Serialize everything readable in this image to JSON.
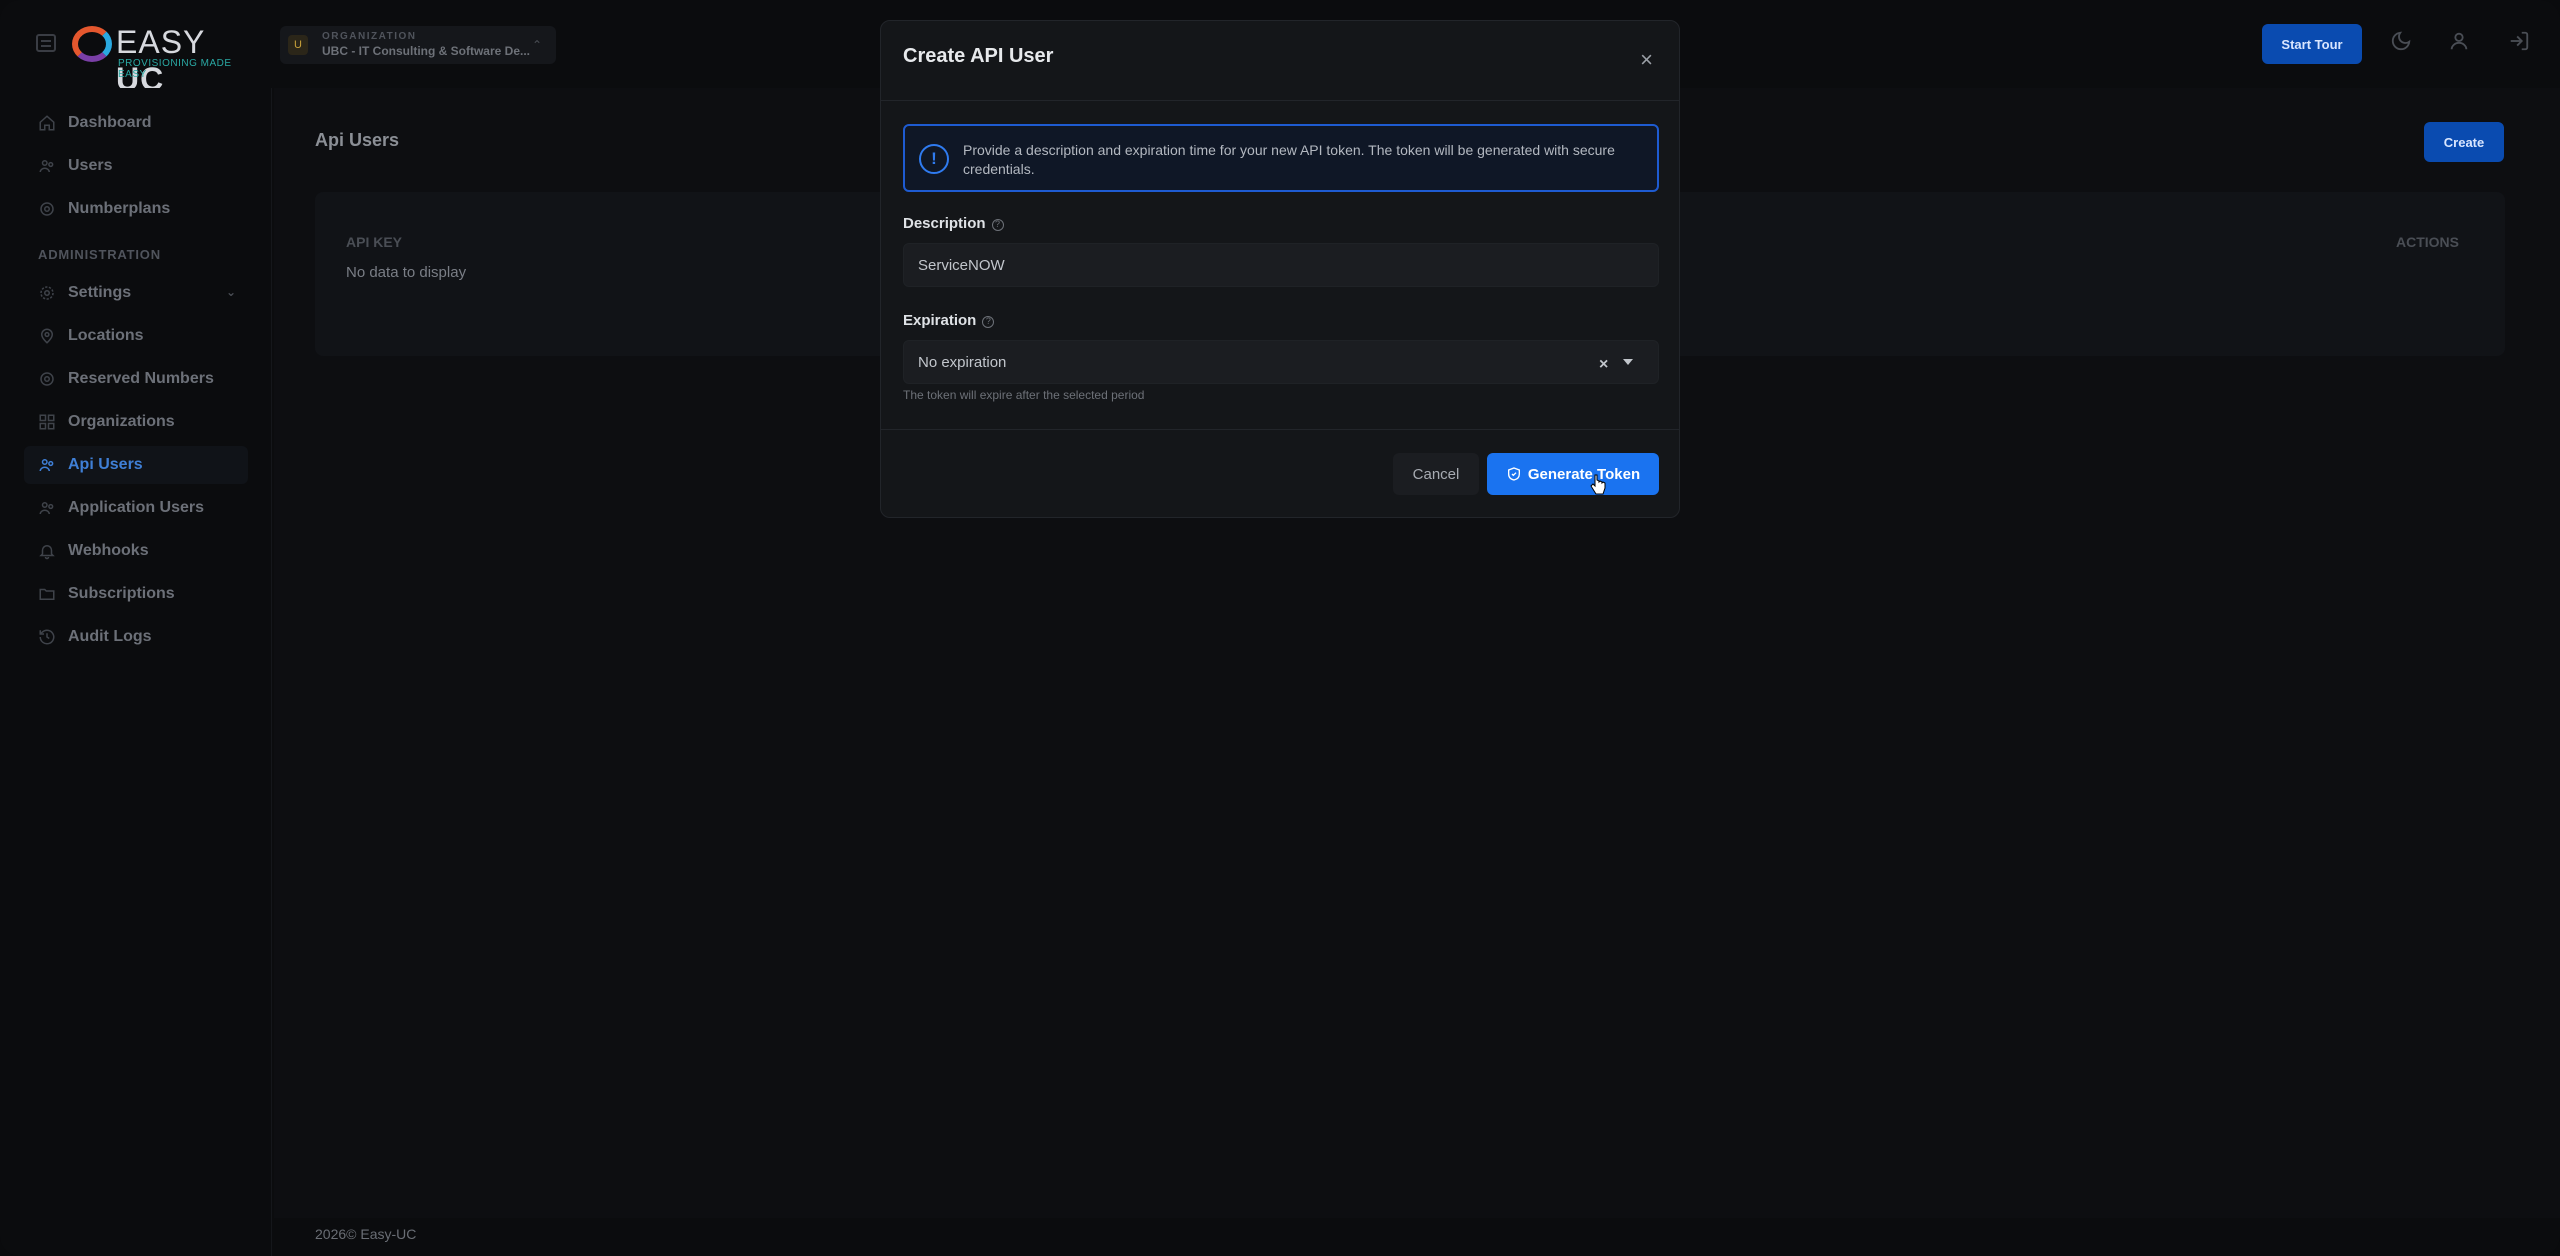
{
  "brand": {
    "logo_text_light": "EASY",
    "logo_text_bold": "UC",
    "tagline": "PROVISIONING MADE EASY"
  },
  "org_selector": {
    "label": "ORGANIZATION",
    "avatar": "U",
    "name": "UBC - IT Consulting & Software De..."
  },
  "header": {
    "start_tour": "Start Tour",
    "icons": [
      "moon-icon",
      "user-icon",
      "logout-icon"
    ]
  },
  "sidebar": {
    "items": [
      {
        "label": "Dashboard",
        "icon": "home-icon"
      },
      {
        "label": "Users",
        "icon": "users-icon"
      },
      {
        "label": "Numberplans",
        "icon": "numberplan-icon"
      }
    ],
    "section": "ADMINISTRATION",
    "admin_items": [
      {
        "label": "Settings",
        "icon": "gear-icon"
      },
      {
        "label": "Locations",
        "icon": "location-icon"
      },
      {
        "label": "Reserved Numbers",
        "icon": "reserved-icon"
      },
      {
        "label": "Organizations",
        "icon": "grid-icon"
      },
      {
        "label": "Api Users",
        "icon": "api-users-icon",
        "active": true
      },
      {
        "label": "Application Users",
        "icon": "app-users-icon"
      },
      {
        "label": "Webhooks",
        "icon": "bell-icon"
      },
      {
        "label": "Subscriptions",
        "icon": "folder-icon"
      },
      {
        "label": "Audit Logs",
        "icon": "history-icon"
      }
    ]
  },
  "main": {
    "title": "Api Users",
    "create_label": "Create",
    "table": {
      "columns": [
        "API KEY",
        "ACTIONS"
      ],
      "empty": "No data to display"
    }
  },
  "footer": {
    "text": "2026© Easy-UC"
  },
  "modal": {
    "title": "Create API User",
    "info": "Provide a description and expiration time for your new API token. The token will be generated with secure credentials.",
    "description": {
      "label": "Description",
      "value": "ServiceNOW"
    },
    "expiration": {
      "label": "Expiration",
      "value": "No expiration",
      "hint": "The token will expire after the selected period"
    },
    "cancel": "Cancel",
    "generate": "Generate Token"
  },
  "colors": {
    "primary": "#1a73f0",
    "active_nav": "#3f7fd6",
    "background": "#0a0b0d"
  }
}
